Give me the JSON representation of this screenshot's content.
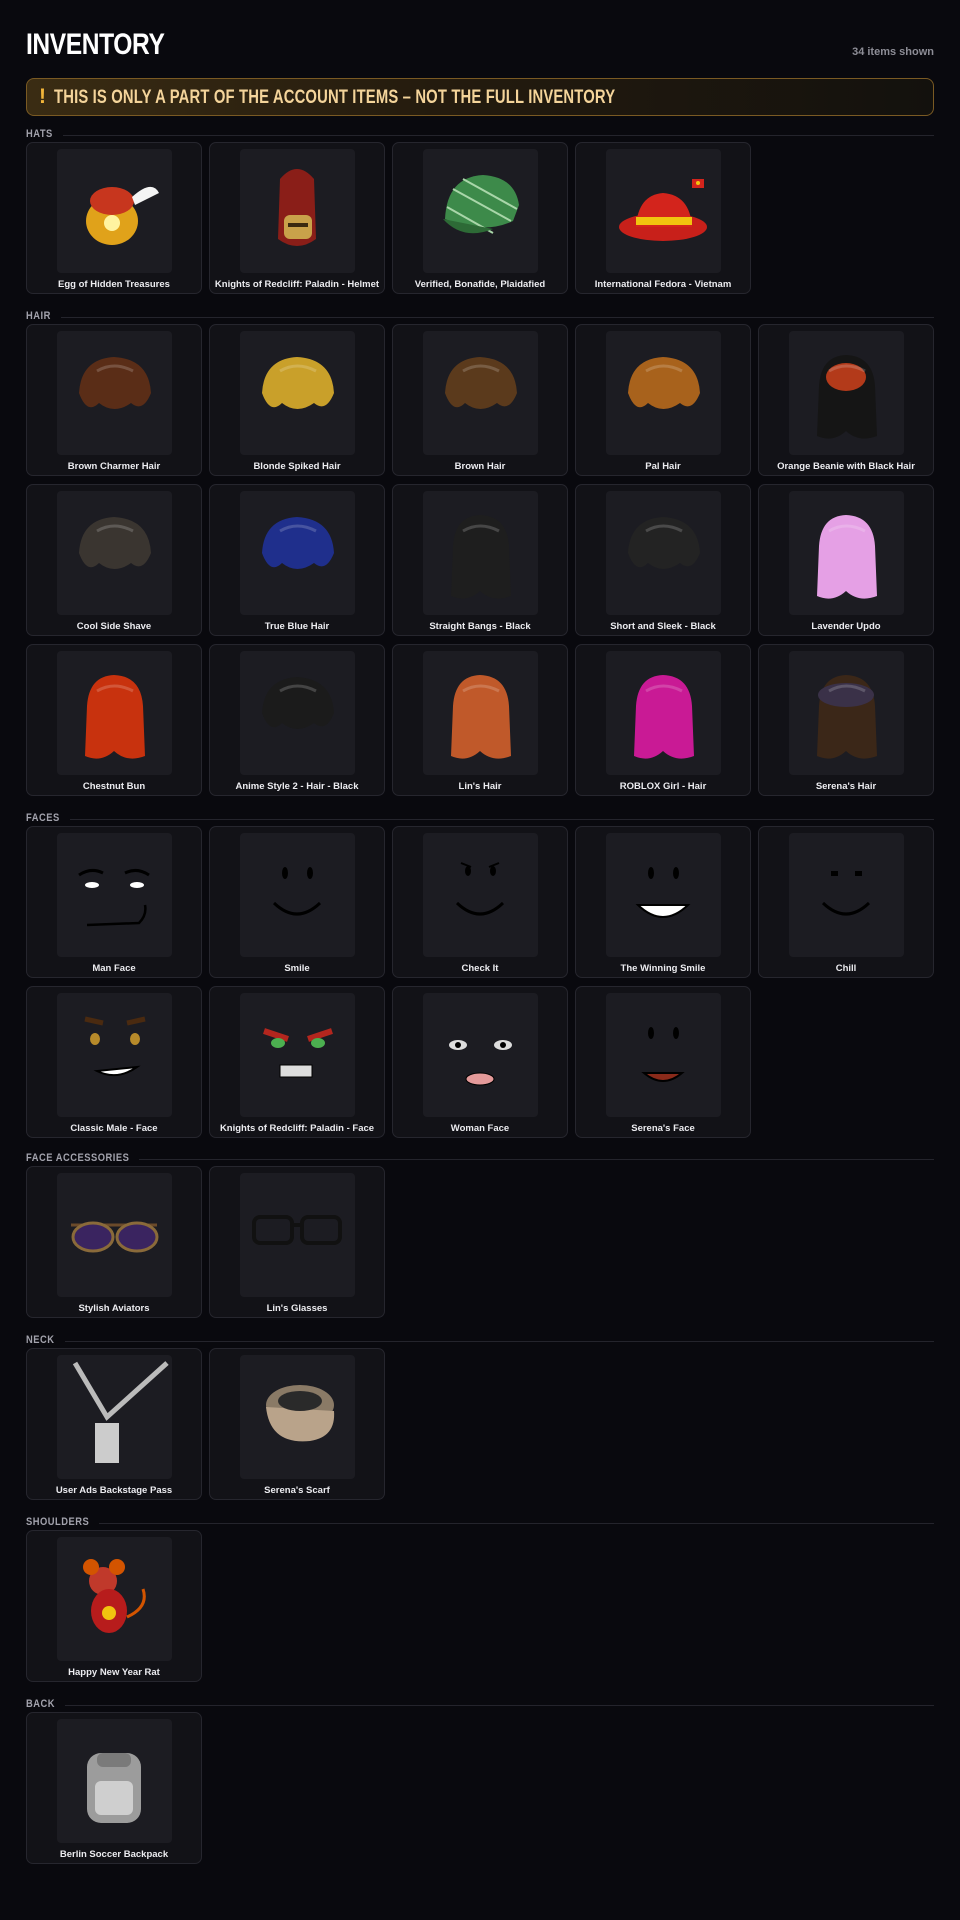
{
  "header": {
    "title": "INVENTORY",
    "count": "34 items shown"
  },
  "warning": {
    "mark": "!",
    "text": "THIS IS ONLY A PART OF THE ACCOUNT ITEMS – NOT THE FULL INVENTORY"
  },
  "colors": {
    "background": "#09090e",
    "card": "#121217",
    "thumb": "#1c1c22",
    "warning_border": "#7a5a23",
    "warning_text": "#f4d49a"
  },
  "sections": [
    {
      "title": "HATS",
      "items": [
        {
          "name": "Egg of Hidden Treasures",
          "icon": "egg-hat-icon"
        },
        {
          "name": "Knights of Redcliff: Paladin - Helmet",
          "icon": "helmet-icon"
        },
        {
          "name": "Verified, Bonafide, Plaidafied",
          "icon": "plaid-cap-icon"
        },
        {
          "name": "International Fedora - Vietnam",
          "icon": "fedora-icon"
        }
      ]
    },
    {
      "title": "HAIR",
      "items": [
        {
          "name": "Brown Charmer Hair",
          "icon": "hair-icon"
        },
        {
          "name": "Blonde Spiked Hair",
          "icon": "hair-icon"
        },
        {
          "name": "Brown Hair",
          "icon": "hair-icon"
        },
        {
          "name": "Pal Hair",
          "icon": "hair-icon"
        },
        {
          "name": "Orange Beanie with Black Hair",
          "icon": "beanie-hair-icon"
        },
        {
          "name": "Cool Side Shave",
          "icon": "hair-icon"
        },
        {
          "name": "True Blue Hair",
          "icon": "hair-icon"
        },
        {
          "name": "Straight Bangs - Black",
          "icon": "long-hair-icon"
        },
        {
          "name": "Short and Sleek - Black",
          "icon": "hair-icon"
        },
        {
          "name": "Lavender Updo",
          "icon": "updo-hair-icon"
        },
        {
          "name": "Chestnut Bun",
          "icon": "bun-hair-icon"
        },
        {
          "name": "Anime Style 2 - Hair - Black",
          "icon": "hair-icon"
        },
        {
          "name": "Lin's Hair",
          "icon": "long-hair-icon"
        },
        {
          "name": "ROBLOX Girl - Hair",
          "icon": "bun-hair-icon"
        },
        {
          "name": "Serena's Hair",
          "icon": "long-hair-icon"
        }
      ]
    },
    {
      "title": "FACES",
      "items": [
        {
          "name": "Man Face",
          "icon": "face-icon"
        },
        {
          "name": "Smile",
          "icon": "face-icon"
        },
        {
          "name": "Check It",
          "icon": "face-icon"
        },
        {
          "name": "The Winning Smile",
          "icon": "face-icon"
        },
        {
          "name": "Chill",
          "icon": "face-icon"
        },
        {
          "name": "Classic Male - Face",
          "icon": "face-icon"
        },
        {
          "name": "Knights of Redcliff: Paladin - Face",
          "icon": "face-icon"
        },
        {
          "name": "Woman Face",
          "icon": "face-icon"
        },
        {
          "name": "Serena's Face",
          "icon": "face-icon"
        }
      ]
    },
    {
      "title": "FACE ACCESSORIES",
      "items": [
        {
          "name": "Stylish Aviators",
          "icon": "sunglasses-icon"
        },
        {
          "name": "Lin's Glasses",
          "icon": "glasses-icon"
        }
      ]
    },
    {
      "title": "NECK",
      "items": [
        {
          "name": "User Ads Backstage Pass",
          "icon": "lanyard-icon"
        },
        {
          "name": "Serena's Scarf",
          "icon": "scarf-icon"
        }
      ]
    },
    {
      "title": "SHOULDERS",
      "items": [
        {
          "name": "Happy New Year Rat",
          "icon": "rat-icon"
        }
      ]
    },
    {
      "title": "BACK",
      "items": [
        {
          "name": "Berlin Soccer Backpack",
          "icon": "backpack-icon"
        }
      ]
    }
  ]
}
